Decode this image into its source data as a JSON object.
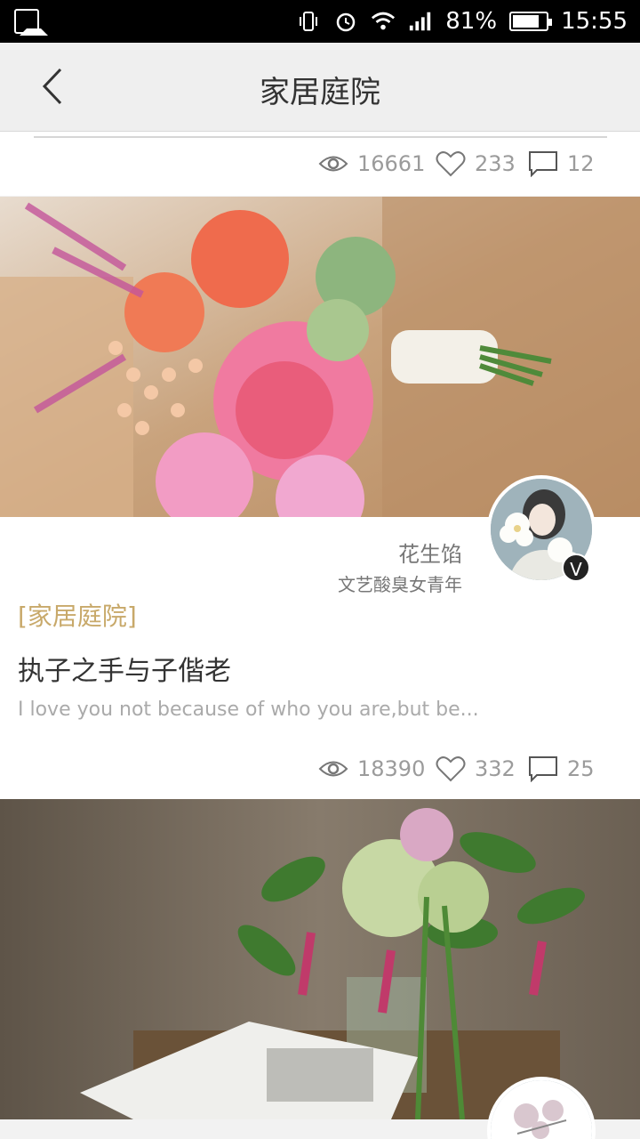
{
  "status": {
    "battery": "81%",
    "time": "15:55",
    "battery_level": 0.81
  },
  "appbar": {
    "title": "家居庭院"
  },
  "feed": [
    {
      "stats": {
        "views": "16661",
        "likes": "233",
        "comments": "12"
      }
    },
    {
      "author": {
        "name": "花生馅",
        "subtitle": "文艺酸臭女青年",
        "badge": "V"
      },
      "category": "[家居庭院]",
      "title": "执子之手与子偕老",
      "excerpt": "I love you not because of who you are,but be...",
      "stats": {
        "views": "18390",
        "likes": "332",
        "comments": "25"
      }
    }
  ],
  "icons": {
    "back": "chevron-left-icon",
    "views": "eye-icon",
    "likes": "heart-icon",
    "comments": "comment-icon"
  },
  "colors": {
    "accent": "#c8a96a",
    "stat_text": "#9b9b9b",
    "title": "#333333"
  }
}
